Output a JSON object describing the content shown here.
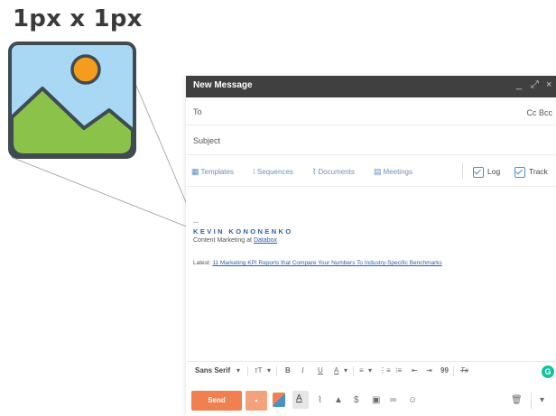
{
  "illustration": {
    "label": "1px x 1px"
  },
  "compose": {
    "title": "New Message",
    "window_controls": {
      "minimize": "_",
      "expand": "⤢",
      "close": "×"
    },
    "to_label": "To",
    "cc_bcc": "Cc  Bcc",
    "subject_label": "Subject",
    "toolbar": {
      "templates": "Templates",
      "sequences": "Sequences",
      "documents": "Documents",
      "meetings": "Meetings",
      "log": "Log",
      "track": "Track"
    },
    "signature": {
      "dash": "--",
      "name": "KEVIN KONONENKO",
      "title_prefix": "Content Marketing at ",
      "company": "Databox",
      "latest_prefix": "Latest: ",
      "latest_link": "11 Marketing KPI Reports that Compare Your Numbers To Industry-Specific Benchmarks"
    },
    "format_bar": {
      "font": "Sans Serif",
      "size": "тT",
      "bold": "B",
      "italic": "I",
      "underline": "U",
      "text_color": "A",
      "quote": "99",
      "clear": "Tx"
    },
    "send_label": "Send"
  },
  "colors": {
    "titlebar": "#404040",
    "send": "#f0804f",
    "link": "#2b5fa8",
    "grammarly": "#15c39a"
  }
}
